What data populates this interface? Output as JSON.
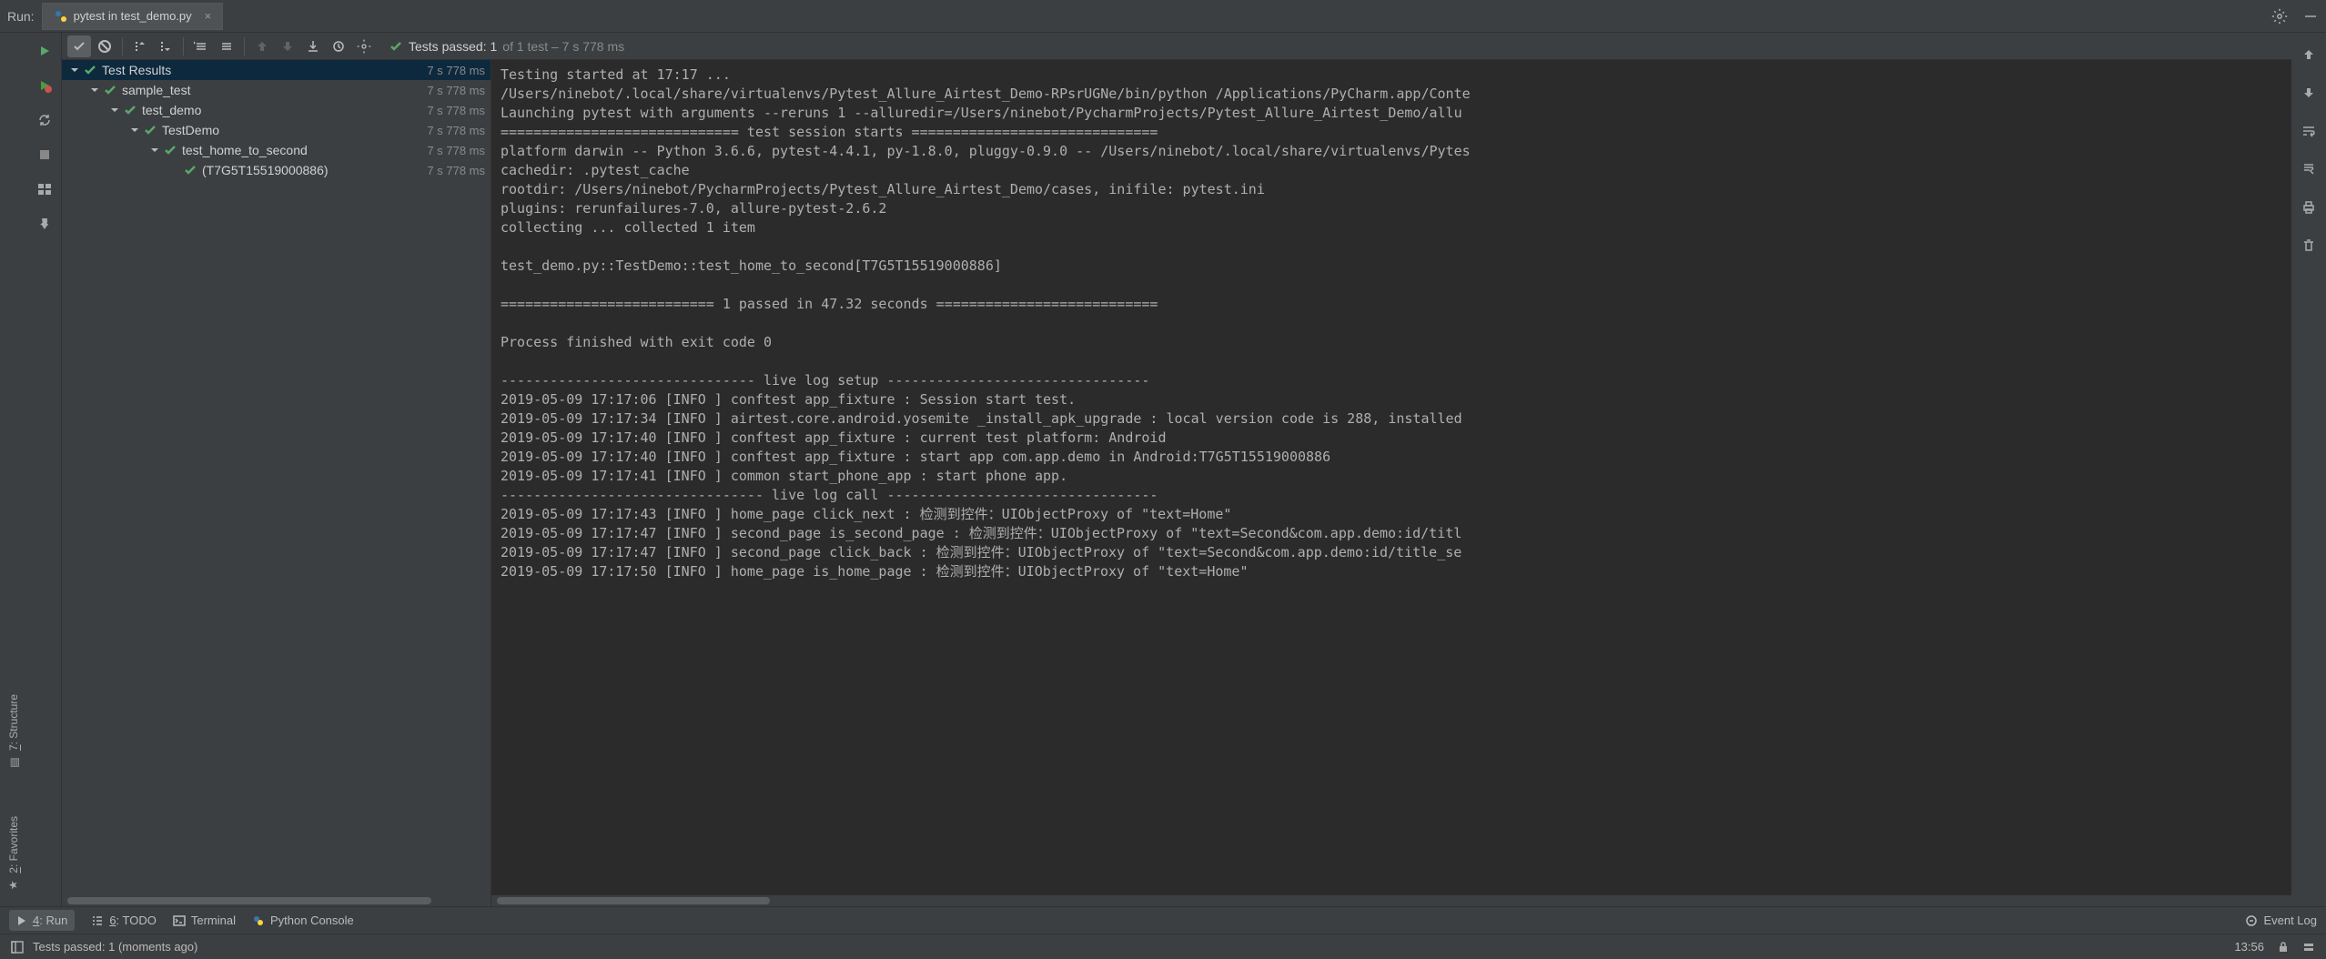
{
  "tab_bar": {
    "run_label": "Run:",
    "tab_title": "pytest in test_demo.py"
  },
  "toolbar_status": {
    "passed_label": "Tests passed:",
    "passed_count": "1",
    "of_text": " of 1 test – 7 s 778 ms"
  },
  "tree": {
    "nodes": [
      {
        "label": "Test Results",
        "time": "7 s 778 ms",
        "indent": 0,
        "selected": true
      },
      {
        "label": "sample_test",
        "time": "7 s 778 ms",
        "indent": 1
      },
      {
        "label": "test_demo",
        "time": "7 s 778 ms",
        "indent": 2
      },
      {
        "label": "TestDemo",
        "time": "7 s 778 ms",
        "indent": 3
      },
      {
        "label": "test_home_to_second",
        "time": "7 s 778 ms",
        "indent": 4
      },
      {
        "label": "(T7G5T15519000886)",
        "time": "7 s 778 ms",
        "indent": 5,
        "leaf": true
      }
    ]
  },
  "console": "Testing started at 17:17 ...\n/Users/ninebot/.local/share/virtualenvs/Pytest_Allure_Airtest_Demo-RPsrUGNe/bin/python /Applications/PyCharm.app/Conte\nLaunching pytest with arguments --reruns 1 --alluredir=/Users/ninebot/PycharmProjects/Pytest_Allure_Airtest_Demo/allu\n============================= test session starts ==============================\nplatform darwin -- Python 3.6.6, pytest-4.4.1, py-1.8.0, pluggy-0.9.0 -- /Users/ninebot/.local/share/virtualenvs/Pytes\ncachedir: .pytest_cache\nrootdir: /Users/ninebot/PycharmProjects/Pytest_Allure_Airtest_Demo/cases, inifile: pytest.ini\nplugins: rerunfailures-7.0, allure-pytest-2.6.2\ncollecting ... collected 1 item\n\ntest_demo.py::TestDemo::test_home_to_second[T7G5T15519000886] \n\n========================== 1 passed in 47.32 seconds ===========================\n\nProcess finished with exit code 0\n\n------------------------------- live log setup --------------------------------\n2019-05-09 17:17:06 [INFO ] conftest app_fixture : Session start test.\n2019-05-09 17:17:34 [INFO ] airtest.core.android.yosemite _install_apk_upgrade : local version code is 288, installed\n2019-05-09 17:17:40 [INFO ] conftest app_fixture : current test platform: Android\n2019-05-09 17:17:40 [INFO ] conftest app_fixture : start app com.app.demo in Android:T7G5T15519000886\n2019-05-09 17:17:41 [INFO ] common start_phone_app : start phone app.\n-------------------------------- live log call ---------------------------------\n2019-05-09 17:17:43 [INFO ] home_page click_next : 检测到控件：UIObjectProxy of \"text=Home\"\n2019-05-09 17:17:47 [INFO ] second_page is_second_page : 检测到控件：UIObjectProxy of \"text=Second&com.app.demo:id/titl\n2019-05-09 17:17:47 [INFO ] second_page click_back : 检测到控件：UIObjectProxy of \"text=Second&com.app.demo:id/title_se\n2019-05-09 17:17:50 [INFO ] home_page is_home_page : 检测到控件：UIObjectProxy of \"text=Home\"",
  "bottom_bar": {
    "run": "4: Run",
    "todo": "6: TODO",
    "terminal": "Terminal",
    "python_console": "Python Console",
    "event_log": "Event Log"
  },
  "footer": {
    "status": "Tests passed: 1 (moments ago)",
    "time": "13:56"
  }
}
